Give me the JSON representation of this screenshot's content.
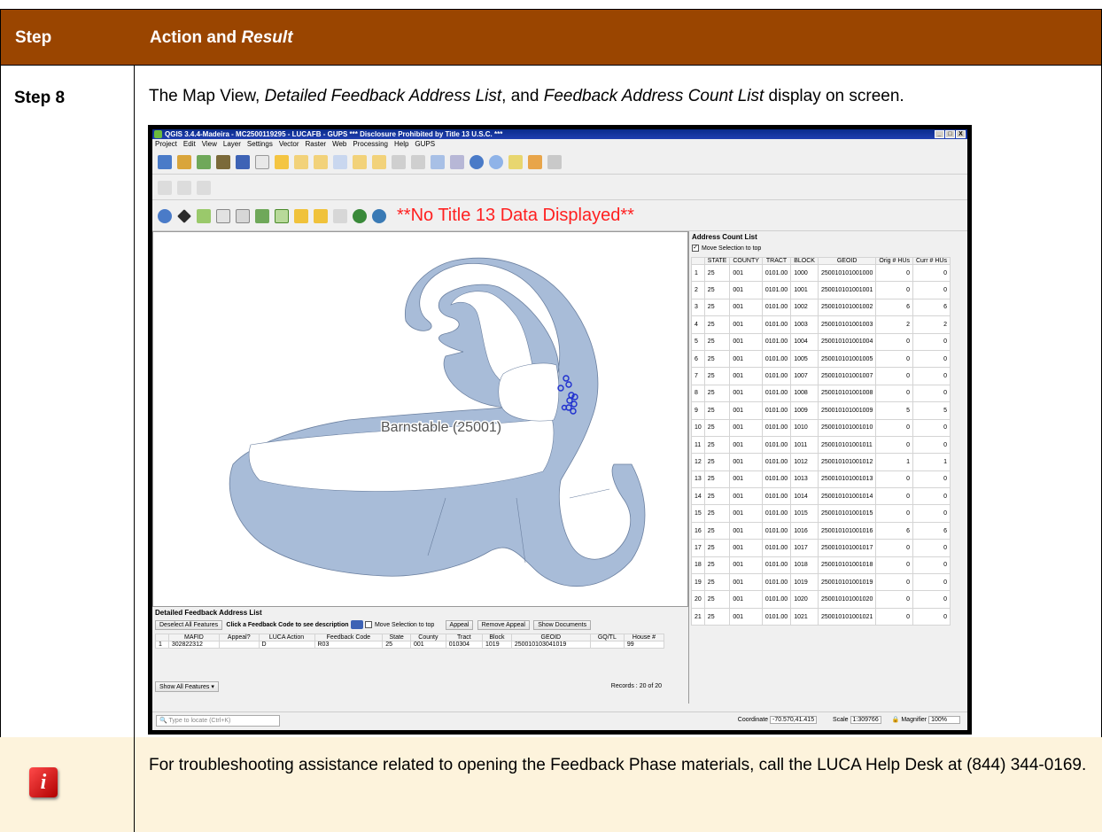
{
  "header": {
    "step": "Step",
    "action": "Action and",
    "result": "Result"
  },
  "row": {
    "step": "Step 8",
    "caption_a": "The Map View, ",
    "caption_b": "Detailed Feedback Address List",
    "caption_c": ", and ",
    "caption_d": "Feedback Address Count List",
    "caption_e": " display on screen."
  },
  "info": {
    "icon": "info-icon",
    "text": "For troubleshooting assistance related to opening the Feedback Phase materials, call the LUCA Help Desk at (844) 344-0169."
  },
  "qgis": {
    "title": "QGIS 3.4.4-Madeira - MC2500119295 - LUCAFB - GUPS     *** Disclosure Prohibited by Title 13 U.S.C. ***",
    "menu": [
      "Project",
      "Edit",
      "View",
      "Layer",
      "Settings",
      "Vector",
      "Raster",
      "Web",
      "Processing",
      "Help",
      "GUPS"
    ],
    "no_title13": "**No Title 13 Data Displayed**",
    "map_label": "Barnstable (25001)",
    "count_list": {
      "title": "Address Count List",
      "move_sel": "Move Selection to top",
      "headers": [
        "",
        "STATE",
        "COUNTY",
        "TRACT",
        "BLOCK",
        "GEOID",
        "Orig # HUs",
        "Curr # HUs"
      ],
      "rows": [
        [
          "1",
          "25",
          "001",
          "0101.00",
          "1000",
          "250010101001000",
          "0",
          "0"
        ],
        [
          "2",
          "25",
          "001",
          "0101.00",
          "1001",
          "250010101001001",
          "0",
          "0"
        ],
        [
          "3",
          "25",
          "001",
          "0101.00",
          "1002",
          "250010101001002",
          "6",
          "6"
        ],
        [
          "4",
          "25",
          "001",
          "0101.00",
          "1003",
          "250010101001003",
          "2",
          "2"
        ],
        [
          "5",
          "25",
          "001",
          "0101.00",
          "1004",
          "250010101001004",
          "0",
          "0"
        ],
        [
          "6",
          "25",
          "001",
          "0101.00",
          "1005",
          "250010101001005",
          "0",
          "0"
        ],
        [
          "7",
          "25",
          "001",
          "0101.00",
          "1007",
          "250010101001007",
          "0",
          "0"
        ],
        [
          "8",
          "25",
          "001",
          "0101.00",
          "1008",
          "250010101001008",
          "0",
          "0"
        ],
        [
          "9",
          "25",
          "001",
          "0101.00",
          "1009",
          "250010101001009",
          "5",
          "5"
        ],
        [
          "10",
          "25",
          "001",
          "0101.00",
          "1010",
          "250010101001010",
          "0",
          "0"
        ],
        [
          "11",
          "25",
          "001",
          "0101.00",
          "1011",
          "250010101001011",
          "0",
          "0"
        ],
        [
          "12",
          "25",
          "001",
          "0101.00",
          "1012",
          "250010101001012",
          "1",
          "1"
        ],
        [
          "13",
          "25",
          "001",
          "0101.00",
          "1013",
          "250010101001013",
          "0",
          "0"
        ],
        [
          "14",
          "25",
          "001",
          "0101.00",
          "1014",
          "250010101001014",
          "0",
          "0"
        ],
        [
          "15",
          "25",
          "001",
          "0101.00",
          "1015",
          "250010101001015",
          "0",
          "0"
        ],
        [
          "16",
          "25",
          "001",
          "0101.00",
          "1016",
          "250010101001016",
          "6",
          "6"
        ],
        [
          "17",
          "25",
          "001",
          "0101.00",
          "1017",
          "250010101001017",
          "0",
          "0"
        ],
        [
          "18",
          "25",
          "001",
          "0101.00",
          "1018",
          "250010101001018",
          "0",
          "0"
        ],
        [
          "19",
          "25",
          "001",
          "0101.00",
          "1019",
          "250010101001019",
          "0",
          "0"
        ],
        [
          "20",
          "25",
          "001",
          "0101.00",
          "1020",
          "250010101001020",
          "0",
          "0"
        ],
        [
          "21",
          "25",
          "001",
          "0101.00",
          "1021",
          "250010101001021",
          "0",
          "0"
        ]
      ]
    },
    "detail": {
      "title": "Detailed Feedback Address List",
      "deselect": "Deselect All Features",
      "hint": "Click a Feedback Code to see description",
      "move_sel": "Move Selection to top",
      "appeal": "Appeal",
      "remove_appeal": "Remove Appeal",
      "show_docs": "Show Documents",
      "headers": [
        "",
        "MAFID",
        "Appeal?",
        "LUCA Action",
        "Feedback Code",
        "State",
        "County",
        "Tract",
        "Block",
        "GEOID",
        "GQ/TL",
        "House #"
      ],
      "row": [
        "1",
        "302822312",
        "",
        "D",
        "R03",
        "25",
        "001",
        "010304",
        "1019",
        "250010103041019",
        "",
        "99"
      ],
      "show_all": "Show All Features",
      "records": "Records : 20 of 20"
    },
    "status": {
      "locate": "Type to locate (Ctrl+K)",
      "coord_label": "Coordinate",
      "coord": "-70.570,41.415",
      "scale_label": "Scale",
      "scale": "1:309766",
      "magnifier_label": "Magnifier",
      "magnifier": "100%"
    }
  }
}
